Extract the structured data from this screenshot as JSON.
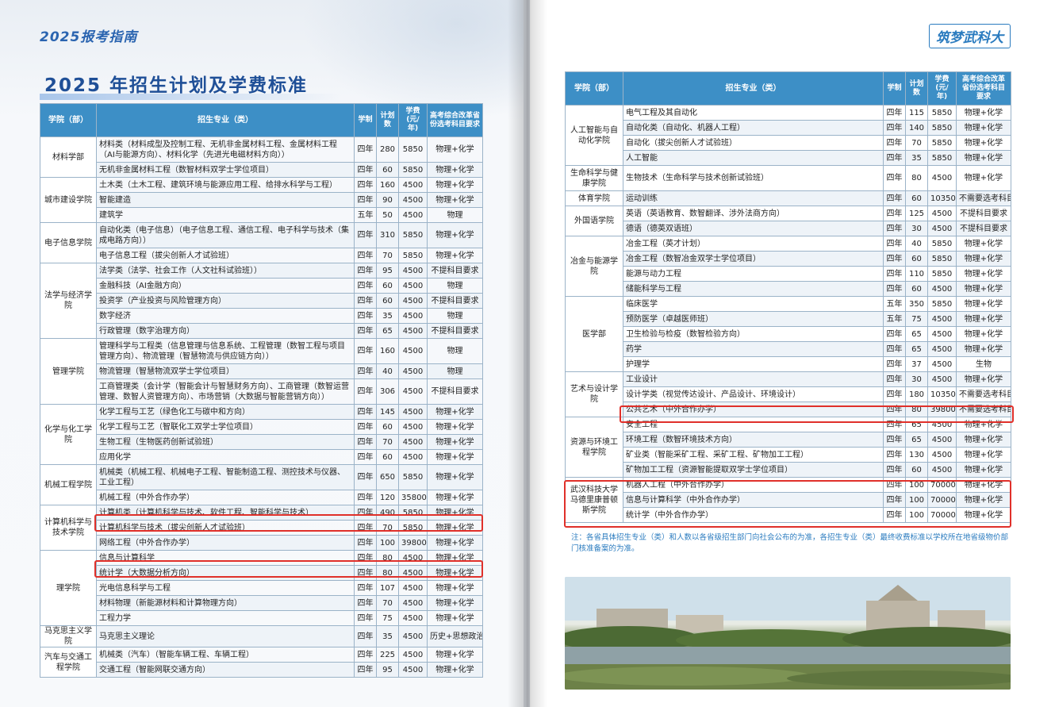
{
  "left": {
    "brand": "2025报考指南",
    "title": "2025 年招生计划及学费标准",
    "headers": [
      "学院（部）",
      "招生专业（类）",
      "学制",
      "计划数",
      "学费(元/年)",
      "高考综合改革省份选考科目要求"
    ],
    "groups": [
      {
        "college": "材料学部",
        "rows": [
          {
            "major": "材料类（材料成型及控制工程、无机非金属材料工程、金属材料工程（AI与能源方向）、材料化学（先进光电磁材料方向））",
            "years": "四年",
            "plan": "280",
            "fee": "5850",
            "req": "物理+化学"
          },
          {
            "major": "无机非金属材料工程（数智材料双学士学位项目）",
            "years": "四年",
            "plan": "60",
            "fee": "5850",
            "req": "物理+化学"
          }
        ]
      },
      {
        "college": "城市建设学院",
        "rows": [
          {
            "major": "土木类（土木工程、建筑环境与能源应用工程、给排水科学与工程）",
            "years": "四年",
            "plan": "160",
            "fee": "4500",
            "req": "物理+化学"
          },
          {
            "major": "智能建造",
            "years": "四年",
            "plan": "90",
            "fee": "4500",
            "req": "物理+化学"
          },
          {
            "major": "建筑学",
            "years": "五年",
            "plan": "50",
            "fee": "4500",
            "req": "物理"
          }
        ]
      },
      {
        "college": "电子信息学院",
        "rows": [
          {
            "major": "自动化类（电子信息）（电子信息工程、通信工程、电子科学与技术（集成电路方向））",
            "years": "四年",
            "plan": "310",
            "fee": "5850",
            "req": "物理+化学"
          },
          {
            "major": "电子信息工程（拔尖创新人才试验班）",
            "years": "四年",
            "plan": "70",
            "fee": "5850",
            "req": "物理+化学"
          }
        ]
      },
      {
        "college": "法学与经济学院",
        "rows": [
          {
            "major": "法学类（法学、社会工作（人文社科试验班））",
            "years": "四年",
            "plan": "95",
            "fee": "4500",
            "req": "不提科目要求"
          },
          {
            "major": "金融科技（AI金融方向）",
            "years": "四年",
            "plan": "60",
            "fee": "4500",
            "req": "物理"
          },
          {
            "major": "投资学（产业投资与风险管理方向）",
            "years": "四年",
            "plan": "60",
            "fee": "4500",
            "req": "不提科目要求"
          },
          {
            "major": "数字经济",
            "years": "四年",
            "plan": "35",
            "fee": "4500",
            "req": "物理"
          },
          {
            "major": "行政管理（数字治理方向）",
            "years": "四年",
            "plan": "65",
            "fee": "4500",
            "req": "不提科目要求"
          }
        ]
      },
      {
        "college": "管理学院",
        "rows": [
          {
            "major": "管理科学与工程类（信息管理与信息系统、工程管理（数智工程与项目管理方向）、物流管理（智慧物流与供应链方向））",
            "years": "四年",
            "plan": "160",
            "fee": "4500",
            "req": "物理"
          },
          {
            "major": "物流管理（智慧物流双学士学位项目）",
            "years": "四年",
            "plan": "40",
            "fee": "4500",
            "req": "物理"
          },
          {
            "major": "工商管理类（会计学（智能会计与智慧财务方向）、工商管理（数智运营管理、数智人资管理方向）、市场营销（大数据与智能营销方向））",
            "years": "四年",
            "plan": "306",
            "fee": "4500",
            "req": "不提科目要求"
          }
        ]
      },
      {
        "college": "化学与化工学院",
        "rows": [
          {
            "major": "化学工程与工艺（绿色化工与碳中和方向）",
            "years": "四年",
            "plan": "145",
            "fee": "4500",
            "req": "物理+化学"
          },
          {
            "major": "化学工程与工艺（智联化工双学士学位项目）",
            "years": "四年",
            "plan": "60",
            "fee": "4500",
            "req": "物理+化学"
          },
          {
            "major": "生物工程（生物医药创新试验班）",
            "years": "四年",
            "plan": "70",
            "fee": "4500",
            "req": "物理+化学"
          },
          {
            "major": "应用化学",
            "years": "四年",
            "plan": "60",
            "fee": "4500",
            "req": "物理+化学"
          }
        ]
      },
      {
        "college": "机械工程学院",
        "rows": [
          {
            "major": "机械类（机械工程、机械电子工程、智能制造工程、测控技术与仪器、工业工程）",
            "years": "四年",
            "plan": "650",
            "fee": "5850",
            "req": "物理+化学"
          },
          {
            "major": "机械工程（中外合作办学）",
            "years": "四年",
            "plan": "120",
            "fee": "35800",
            "req": "物理+化学"
          }
        ]
      },
      {
        "college": "计算机科学与技术学院",
        "rows": [
          {
            "major": "计算机类（计算机科学与技术、软件工程、智能科学与技术）",
            "years": "四年",
            "plan": "490",
            "fee": "5850",
            "req": "物理+化学"
          },
          {
            "major": "计算机科学与技术（拔尖创新人才试验班）",
            "years": "四年",
            "plan": "70",
            "fee": "5850",
            "req": "物理+化学"
          },
          {
            "major": "网络工程（中外合作办学）",
            "years": "四年",
            "plan": "100",
            "fee": "39800",
            "req": "物理+化学"
          }
        ]
      },
      {
        "college": "理学院",
        "rows": [
          {
            "major": "信息与计算科学",
            "years": "四年",
            "plan": "80",
            "fee": "4500",
            "req": "物理+化学"
          },
          {
            "major": "统计学（大数据分析方向）",
            "years": "四年",
            "plan": "80",
            "fee": "4500",
            "req": "物理+化学"
          },
          {
            "major": "光电信息科学与工程",
            "years": "四年",
            "plan": "107",
            "fee": "4500",
            "req": "物理+化学"
          },
          {
            "major": "材料物理（新能源材料和计算物理方向）",
            "years": "四年",
            "plan": "70",
            "fee": "4500",
            "req": "物理+化学"
          },
          {
            "major": "工程力学",
            "years": "四年",
            "plan": "75",
            "fee": "4500",
            "req": "物理+化学"
          }
        ]
      },
      {
        "college": "马克思主义学院",
        "rows": [
          {
            "major": "马克思主义理论",
            "years": "四年",
            "plan": "35",
            "fee": "4500",
            "req": "历史+思想政治"
          }
        ]
      },
      {
        "college": "汽车与交通工程学院",
        "rows": [
          {
            "major": "机械类（汽车）（智能车辆工程、车辆工程）",
            "years": "四年",
            "plan": "225",
            "fee": "4500",
            "req": "物理+化学"
          },
          {
            "major": "交通工程（智能网联交通方向）",
            "years": "四年",
            "plan": "95",
            "fee": "4500",
            "req": "物理+化学"
          }
        ]
      }
    ]
  },
  "right": {
    "logo": "筑梦武科大",
    "headers": [
      "学院（部）",
      "招生专业（类）",
      "学制",
      "计划数",
      "学费(元/年)",
      "高考综合改革省份选考科目要求"
    ],
    "groups": [
      {
        "college": "人工智能与自动化学院",
        "rows": [
          {
            "major": "电气工程及其自动化",
            "years": "四年",
            "plan": "115",
            "fee": "5850",
            "req": "物理+化学"
          },
          {
            "major": "自动化类（自动化、机器人工程）",
            "years": "四年",
            "plan": "140",
            "fee": "5850",
            "req": "物理+化学"
          },
          {
            "major": "自动化（拔尖创新人才试验班）",
            "years": "四年",
            "plan": "70",
            "fee": "5850",
            "req": "物理+化学"
          },
          {
            "major": "人工智能",
            "years": "四年",
            "plan": "35",
            "fee": "5850",
            "req": "物理+化学"
          }
        ]
      },
      {
        "college": "生命科学与健康学院",
        "rows": [
          {
            "major": "生物技术（生命科学与技术创新试验班）",
            "years": "四年",
            "plan": "80",
            "fee": "4500",
            "req": "物理+化学"
          }
        ]
      },
      {
        "college": "体育学院",
        "rows": [
          {
            "major": "运动训练",
            "years": "四年",
            "plan": "60",
            "fee": "10350",
            "req": "不需要选考科目"
          }
        ]
      },
      {
        "college": "外国语学院",
        "rows": [
          {
            "major": "英语（英语教育、数智翻译、涉外法商方向）",
            "years": "四年",
            "plan": "125",
            "fee": "4500",
            "req": "不提科目要求"
          },
          {
            "major": "德语（德英双语班）",
            "years": "四年",
            "plan": "30",
            "fee": "4500",
            "req": "不提科目要求"
          }
        ]
      },
      {
        "college": "冶金与能源学院",
        "rows": [
          {
            "major": "冶金工程（英才计划）",
            "years": "四年",
            "plan": "40",
            "fee": "5850",
            "req": "物理+化学"
          },
          {
            "major": "冶金工程（数智冶金双学士学位项目）",
            "years": "四年",
            "plan": "60",
            "fee": "5850",
            "req": "物理+化学"
          },
          {
            "major": "能源与动力工程",
            "years": "四年",
            "plan": "110",
            "fee": "5850",
            "req": "物理+化学"
          },
          {
            "major": "储能科学与工程",
            "years": "四年",
            "plan": "60",
            "fee": "4500",
            "req": "物理+化学"
          }
        ]
      },
      {
        "college": "医学部",
        "rows": [
          {
            "major": "临床医学",
            "years": "五年",
            "plan": "350",
            "fee": "5850",
            "req": "物理+化学"
          },
          {
            "major": "预防医学（卓越医师班）",
            "years": "五年",
            "plan": "75",
            "fee": "4500",
            "req": "物理+化学"
          },
          {
            "major": "卫生检验与检疫（数智检验方向）",
            "years": "四年",
            "plan": "65",
            "fee": "4500",
            "req": "物理+化学"
          },
          {
            "major": "药学",
            "years": "四年",
            "plan": "65",
            "fee": "4500",
            "req": "物理+化学"
          },
          {
            "major": "护理学",
            "years": "四年",
            "plan": "37",
            "fee": "4500",
            "req": "生物"
          }
        ]
      },
      {
        "college": "艺术与设计学院",
        "rows": [
          {
            "major": "工业设计",
            "years": "四年",
            "plan": "30",
            "fee": "4500",
            "req": "物理+化学"
          },
          {
            "major": "设计学类（视觉传达设计、产品设计、环境设计）",
            "years": "四年",
            "plan": "180",
            "fee": "10350",
            "req": "不需要选考科目"
          },
          {
            "major": "公共艺术（中外合作办学）",
            "years": "四年",
            "plan": "80",
            "fee": "39800",
            "req": "不需要选考科目"
          }
        ]
      },
      {
        "college": "资源与环境工程学院",
        "rows": [
          {
            "major": "安全工程",
            "years": "四年",
            "plan": "65",
            "fee": "4500",
            "req": "物理+化学"
          },
          {
            "major": "环境工程（数智环境技术方向）",
            "years": "四年",
            "plan": "65",
            "fee": "4500",
            "req": "物理+化学"
          },
          {
            "major": "矿业类（智能采矿工程、采矿工程、矿物加工工程）",
            "years": "四年",
            "plan": "130",
            "fee": "4500",
            "req": "物理+化学"
          },
          {
            "major": "矿物加工工程（资源智能提取双学士学位项目）",
            "years": "四年",
            "plan": "60",
            "fee": "4500",
            "req": "物理+化学"
          }
        ]
      },
      {
        "college": "武汉科技大学马德里康普顿斯学院",
        "rows": [
          {
            "major": "机器人工程（中外合作办学）",
            "years": "四年",
            "plan": "100",
            "fee": "70000",
            "req": "物理+化学"
          },
          {
            "major": "信息与计算科学（中外合作办学）",
            "years": "四年",
            "plan": "100",
            "fee": "70000",
            "req": "物理+化学"
          },
          {
            "major": "统计学（中外合作办学）",
            "years": "四年",
            "plan": "100",
            "fee": "70000",
            "req": "物理+化学"
          }
        ]
      }
    ],
    "note": "注：各省具体招生专业（类）和人数以各省级招生部门向社会公布的为准，各招生专业（类）最终收费标准以学校所在地省级物价部门核准备案的为准。"
  }
}
